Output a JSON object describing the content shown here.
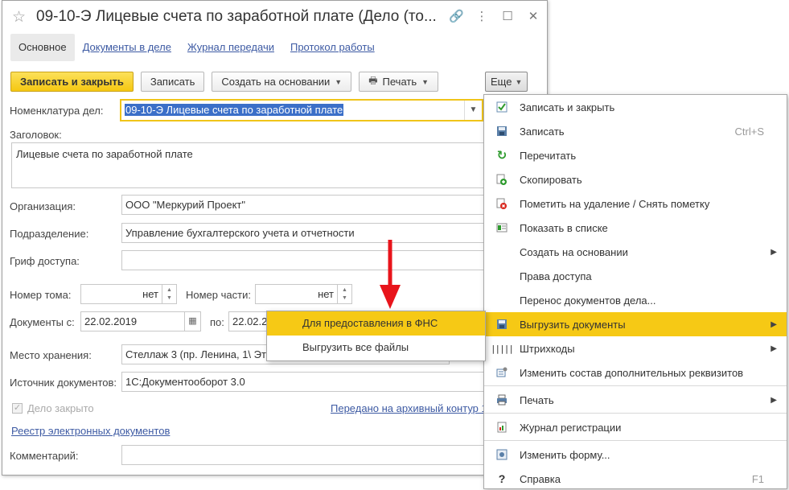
{
  "window": {
    "title": "09-10-Э Лицевые счета по заработной плате (Дело (то...",
    "title_icons": [
      "link-icon",
      "more-icon",
      "maximize-icon",
      "close-icon"
    ]
  },
  "tabs": [
    {
      "label": "Основное"
    },
    {
      "label": "Документы в деле"
    },
    {
      "label": "Журнал передачи"
    },
    {
      "label": "Протокол работы"
    }
  ],
  "toolbar": {
    "save_close": "Записать и закрыть",
    "save": "Записать",
    "create_based": "Создать на основании",
    "print": "Печать",
    "more": "Еще"
  },
  "form": {
    "nomenclature_label": "Номенклатура дел:",
    "nomenclature_value": "09-10-Э Лицевые счета по заработной плате",
    "heading_label": "Заголовок:",
    "heading_value": "Лицевые счета по заработной плате",
    "org_label": "Организация:",
    "org_value": "ООО \"Меркурий Проект\"",
    "dept_label": "Подразделение:",
    "dept_value": "Управление бухгалтерского учета и отчетности",
    "access_label": "Гриф доступа:",
    "access_value": "",
    "volume_label": "Номер тома:",
    "volume_value": "нет",
    "part_label": "Номер части:",
    "part_value": "нет",
    "docs_from_label": "Документы с:",
    "docs_from_value": "22.02.2019",
    "docs_to_label": "по:",
    "docs_to_value": "22.02.2",
    "storage_label": "Место хранения:",
    "storage_value": "Стеллаж 3 (пр. Ленина, 1\\ Эта",
    "source_label": "Источник документов:",
    "source_value": "1С:Документооборот 3.0",
    "closed_label": "Дело закрыто",
    "archive_link": "Передано на архивный контур 1",
    "registry_link": "Реестр электронных документов",
    "comment_label": "Комментарий:",
    "comment_value": ""
  },
  "menu": {
    "items": [
      {
        "label": "Записать и закрыть",
        "icon": "save-close-icon",
        "shortcut": "",
        "arrow": false
      },
      {
        "label": "Записать",
        "icon": "floppy-icon",
        "shortcut": "Ctrl+S",
        "arrow": false
      },
      {
        "label": "Перечитать",
        "icon": "refresh-icon",
        "shortcut": "",
        "arrow": false
      },
      {
        "label": "Скопировать",
        "icon": "copy-icon",
        "shortcut": "",
        "arrow": false
      },
      {
        "label": "Пометить на удаление / Снять пометку",
        "icon": "delete-mark-icon",
        "shortcut": "",
        "arrow": false
      },
      {
        "label": "Показать в списке",
        "icon": "list-icon",
        "shortcut": "",
        "arrow": false
      },
      {
        "label": "Создать на основании",
        "icon": "",
        "shortcut": "",
        "arrow": true
      },
      {
        "label": "Права доступа",
        "icon": "",
        "shortcut": "",
        "arrow": false
      },
      {
        "label": "Перенос документов дела...",
        "icon": "",
        "shortcut": "",
        "arrow": false
      },
      {
        "label": "Выгрузить документы",
        "icon": "export-icon",
        "shortcut": "",
        "arrow": true,
        "selected": true
      },
      {
        "label": "Штрихкоды",
        "icon": "barcode-icon",
        "shortcut": "",
        "arrow": true
      },
      {
        "label": "Изменить состав дополнительных реквизитов",
        "icon": "attributes-icon",
        "shortcut": "",
        "arrow": false
      },
      {
        "label": "Печать",
        "icon": "printer-icon",
        "shortcut": "",
        "arrow": true
      },
      {
        "label": "Журнал регистрации",
        "icon": "journal-icon",
        "shortcut": "",
        "arrow": false
      },
      {
        "label": "Изменить форму...",
        "icon": "form-icon",
        "shortcut": "",
        "arrow": false
      },
      {
        "label": "Справка",
        "icon": "help-icon",
        "shortcut": "F1",
        "arrow": false
      }
    ]
  },
  "submenu": {
    "items": [
      {
        "label": "Для предоставления в ФНС"
      },
      {
        "label": "Выгрузить все файлы"
      }
    ]
  },
  "colors": {
    "accent_yellow": "#f6c915",
    "link_blue": "#3d5aa3",
    "annotation_red": "#e8141b"
  }
}
